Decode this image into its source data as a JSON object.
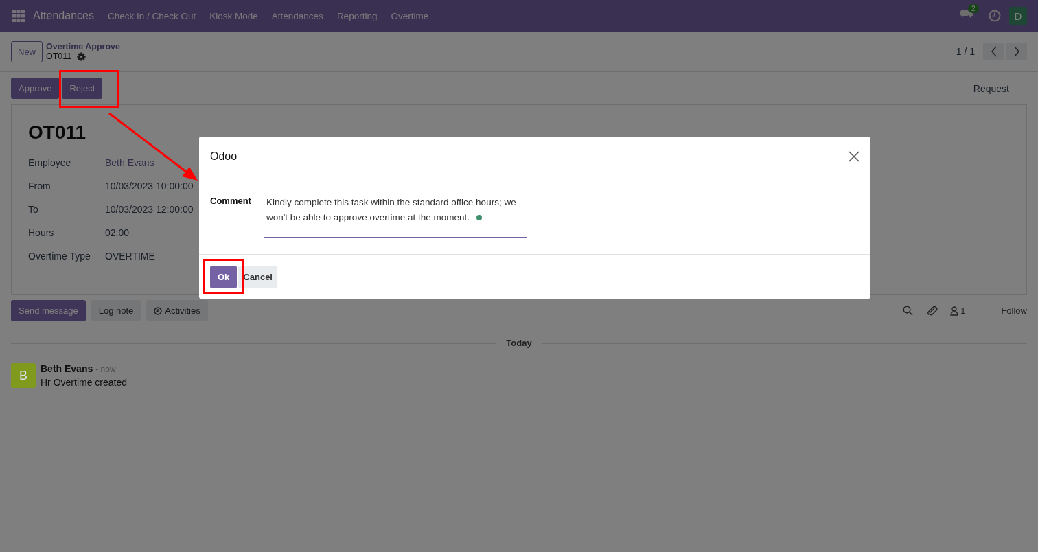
{
  "navbar": {
    "app_name": "Attendances",
    "menu": [
      "Check In / Check Out",
      "Kiosk Mode",
      "Attendances",
      "Reporting",
      "Overtime"
    ],
    "messages_count": "2",
    "user_initial": "D"
  },
  "control_panel": {
    "new_button": "New",
    "breadcrumb_parent": "Overtime Approve",
    "record_name": "OT011",
    "pager": "1 / 1"
  },
  "actions": {
    "buttons": [
      "Approve",
      "Reject"
    ],
    "status": "Request"
  },
  "form": {
    "title": "OT011",
    "fields": [
      {
        "label": "Employee",
        "value": "Beth Evans",
        "kind": "link"
      },
      {
        "label": "From",
        "value": "10/03/2023 10:00:00",
        "kind": "text"
      },
      {
        "label": "To",
        "value": "10/03/2023 12:00:00",
        "kind": "text"
      },
      {
        "label": "Hours",
        "value": "02:00",
        "kind": "text"
      },
      {
        "label": "Overtime Type",
        "value": "OVERTIME",
        "kind": "text"
      }
    ]
  },
  "chatter": {
    "buttons": [
      {
        "label": "Send message",
        "kind": "primary"
      },
      {
        "label": "Log note",
        "kind": "secondary"
      },
      {
        "label": "Activities",
        "kind": "activities"
      }
    ],
    "followers_count": "1",
    "follow": "Follow",
    "divider": "Today",
    "messages": [
      {
        "initial": "B",
        "color": "#7f9a1c",
        "author": "Beth Evans",
        "time": "- now",
        "body": "Hr Overtime created"
      }
    ]
  },
  "dialog": {
    "title": "Odoo",
    "field_label": "Comment",
    "value": "Kindly complete this task within the standard office hours; we won't be able to approve overtime at the moment.",
    "buttons": [
      {
        "label": "Ok",
        "kind": "primary"
      },
      {
        "label": "Cancel",
        "kind": "secondary"
      }
    ]
  }
}
